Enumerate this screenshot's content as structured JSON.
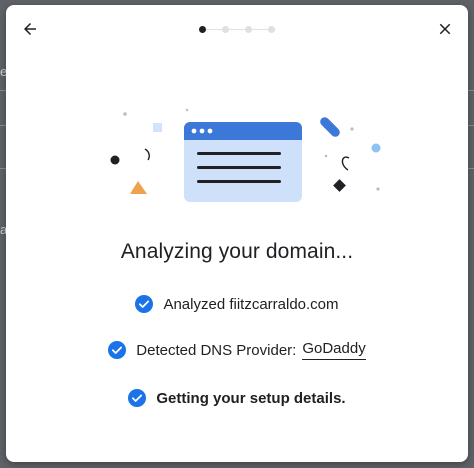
{
  "background": {
    "left_letters": [
      "e",
      "a"
    ]
  },
  "dialog": {
    "back_icon": "arrow-left-icon",
    "close_icon": "close-icon",
    "stepper": {
      "total_steps": 4,
      "current_step": 1
    },
    "title": "Analyzing your domain...",
    "status_items": [
      {
        "icon": "check-circle-icon",
        "text": "Analyzed fiitzcarraldo.com"
      },
      {
        "icon": "check-circle-icon",
        "label": "Detected DNS Provider:",
        "value": "GoDaddy"
      },
      {
        "icon": "check-circle-icon",
        "text": "Getting your setup details."
      }
    ],
    "colors": {
      "accent": "#3c78d8",
      "check": "#1a73e8",
      "browser_fill": "#cfe0fb",
      "triangle": "#f0a24a",
      "light_blue": "#8ec3f1"
    }
  }
}
